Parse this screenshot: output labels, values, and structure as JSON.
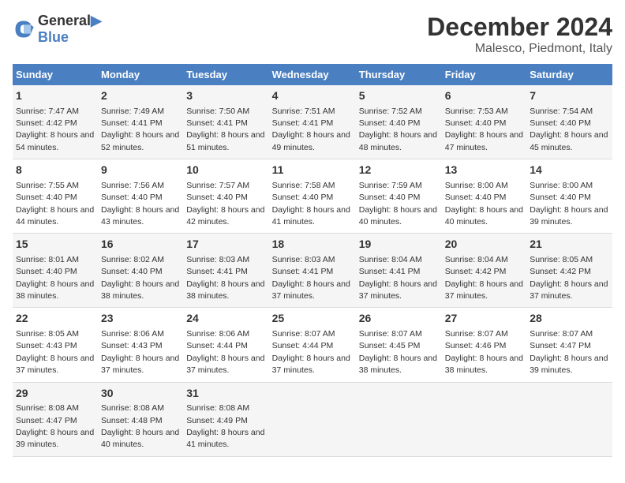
{
  "logo": {
    "line1": "General",
    "line2": "Blue"
  },
  "title": "December 2024",
  "subtitle": "Malesco, Piedmont, Italy",
  "days_header": [
    "Sunday",
    "Monday",
    "Tuesday",
    "Wednesday",
    "Thursday",
    "Friday",
    "Saturday"
  ],
  "weeks": [
    [
      {
        "day": "1",
        "sunrise": "Sunrise: 7:47 AM",
        "sunset": "Sunset: 4:42 PM",
        "daylight": "Daylight: 8 hours and 54 minutes."
      },
      {
        "day": "2",
        "sunrise": "Sunrise: 7:49 AM",
        "sunset": "Sunset: 4:41 PM",
        "daylight": "Daylight: 8 hours and 52 minutes."
      },
      {
        "day": "3",
        "sunrise": "Sunrise: 7:50 AM",
        "sunset": "Sunset: 4:41 PM",
        "daylight": "Daylight: 8 hours and 51 minutes."
      },
      {
        "day": "4",
        "sunrise": "Sunrise: 7:51 AM",
        "sunset": "Sunset: 4:41 PM",
        "daylight": "Daylight: 8 hours and 49 minutes."
      },
      {
        "day": "5",
        "sunrise": "Sunrise: 7:52 AM",
        "sunset": "Sunset: 4:40 PM",
        "daylight": "Daylight: 8 hours and 48 minutes."
      },
      {
        "day": "6",
        "sunrise": "Sunrise: 7:53 AM",
        "sunset": "Sunset: 4:40 PM",
        "daylight": "Daylight: 8 hours and 47 minutes."
      },
      {
        "day": "7",
        "sunrise": "Sunrise: 7:54 AM",
        "sunset": "Sunset: 4:40 PM",
        "daylight": "Daylight: 8 hours and 45 minutes."
      }
    ],
    [
      {
        "day": "8",
        "sunrise": "Sunrise: 7:55 AM",
        "sunset": "Sunset: 4:40 PM",
        "daylight": "Daylight: 8 hours and 44 minutes."
      },
      {
        "day": "9",
        "sunrise": "Sunrise: 7:56 AM",
        "sunset": "Sunset: 4:40 PM",
        "daylight": "Daylight: 8 hours and 43 minutes."
      },
      {
        "day": "10",
        "sunrise": "Sunrise: 7:57 AM",
        "sunset": "Sunset: 4:40 PM",
        "daylight": "Daylight: 8 hours and 42 minutes."
      },
      {
        "day": "11",
        "sunrise": "Sunrise: 7:58 AM",
        "sunset": "Sunset: 4:40 PM",
        "daylight": "Daylight: 8 hours and 41 minutes."
      },
      {
        "day": "12",
        "sunrise": "Sunrise: 7:59 AM",
        "sunset": "Sunset: 4:40 PM",
        "daylight": "Daylight: 8 hours and 40 minutes."
      },
      {
        "day": "13",
        "sunrise": "Sunrise: 8:00 AM",
        "sunset": "Sunset: 4:40 PM",
        "daylight": "Daylight: 8 hours and 40 minutes."
      },
      {
        "day": "14",
        "sunrise": "Sunrise: 8:00 AM",
        "sunset": "Sunset: 4:40 PM",
        "daylight": "Daylight: 8 hours and 39 minutes."
      }
    ],
    [
      {
        "day": "15",
        "sunrise": "Sunrise: 8:01 AM",
        "sunset": "Sunset: 4:40 PM",
        "daylight": "Daylight: 8 hours and 38 minutes."
      },
      {
        "day": "16",
        "sunrise": "Sunrise: 8:02 AM",
        "sunset": "Sunset: 4:40 PM",
        "daylight": "Daylight: 8 hours and 38 minutes."
      },
      {
        "day": "17",
        "sunrise": "Sunrise: 8:03 AM",
        "sunset": "Sunset: 4:41 PM",
        "daylight": "Daylight: 8 hours and 38 minutes."
      },
      {
        "day": "18",
        "sunrise": "Sunrise: 8:03 AM",
        "sunset": "Sunset: 4:41 PM",
        "daylight": "Daylight: 8 hours and 37 minutes."
      },
      {
        "day": "19",
        "sunrise": "Sunrise: 8:04 AM",
        "sunset": "Sunset: 4:41 PM",
        "daylight": "Daylight: 8 hours and 37 minutes."
      },
      {
        "day": "20",
        "sunrise": "Sunrise: 8:04 AM",
        "sunset": "Sunset: 4:42 PM",
        "daylight": "Daylight: 8 hours and 37 minutes."
      },
      {
        "day": "21",
        "sunrise": "Sunrise: 8:05 AM",
        "sunset": "Sunset: 4:42 PM",
        "daylight": "Daylight: 8 hours and 37 minutes."
      }
    ],
    [
      {
        "day": "22",
        "sunrise": "Sunrise: 8:05 AM",
        "sunset": "Sunset: 4:43 PM",
        "daylight": "Daylight: 8 hours and 37 minutes."
      },
      {
        "day": "23",
        "sunrise": "Sunrise: 8:06 AM",
        "sunset": "Sunset: 4:43 PM",
        "daylight": "Daylight: 8 hours and 37 minutes."
      },
      {
        "day": "24",
        "sunrise": "Sunrise: 8:06 AM",
        "sunset": "Sunset: 4:44 PM",
        "daylight": "Daylight: 8 hours and 37 minutes."
      },
      {
        "day": "25",
        "sunrise": "Sunrise: 8:07 AM",
        "sunset": "Sunset: 4:44 PM",
        "daylight": "Daylight: 8 hours and 37 minutes."
      },
      {
        "day": "26",
        "sunrise": "Sunrise: 8:07 AM",
        "sunset": "Sunset: 4:45 PM",
        "daylight": "Daylight: 8 hours and 38 minutes."
      },
      {
        "day": "27",
        "sunrise": "Sunrise: 8:07 AM",
        "sunset": "Sunset: 4:46 PM",
        "daylight": "Daylight: 8 hours and 38 minutes."
      },
      {
        "day": "28",
        "sunrise": "Sunrise: 8:07 AM",
        "sunset": "Sunset: 4:47 PM",
        "daylight": "Daylight: 8 hours and 39 minutes."
      }
    ],
    [
      {
        "day": "29",
        "sunrise": "Sunrise: 8:08 AM",
        "sunset": "Sunset: 4:47 PM",
        "daylight": "Daylight: 8 hours and 39 minutes."
      },
      {
        "day": "30",
        "sunrise": "Sunrise: 8:08 AM",
        "sunset": "Sunset: 4:48 PM",
        "daylight": "Daylight: 8 hours and 40 minutes."
      },
      {
        "day": "31",
        "sunrise": "Sunrise: 8:08 AM",
        "sunset": "Sunset: 4:49 PM",
        "daylight": "Daylight: 8 hours and 41 minutes."
      },
      {
        "day": "",
        "sunrise": "",
        "sunset": "",
        "daylight": ""
      },
      {
        "day": "",
        "sunrise": "",
        "sunset": "",
        "daylight": ""
      },
      {
        "day": "",
        "sunrise": "",
        "sunset": "",
        "daylight": ""
      },
      {
        "day": "",
        "sunrise": "",
        "sunset": "",
        "daylight": ""
      }
    ]
  ]
}
